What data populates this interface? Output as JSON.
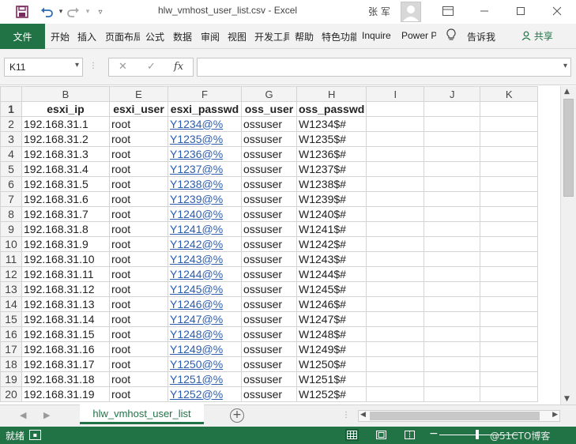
{
  "titlebar": {
    "title": "hlw_vmhost_user_list.csv  -  Excel",
    "user": "张 军",
    "icons": [
      "save-icon",
      "undo-icon",
      "redo-icon",
      "customize-qat-icon",
      "avatar",
      "ribbon-display-icon",
      "minimize-icon",
      "maximize-icon",
      "close-icon"
    ]
  },
  "ribbon": {
    "file_tab": "文件",
    "tabs": [
      "开始",
      "插入",
      "页面布局",
      "公式",
      "数据",
      "审阅",
      "视图",
      "开发工具",
      "帮助",
      "特色功能",
      "Inquire",
      "Power Pivot"
    ],
    "tell_me": "告诉我",
    "share": "共享"
  },
  "formula_bar": {
    "name_box": "K11",
    "cancel_glyph": "✕",
    "enter_glyph": "✓",
    "fx_label": "fx",
    "formula": ""
  },
  "sheet": {
    "column_headers": [
      "B",
      "E",
      "F",
      "G",
      "H",
      "I",
      "J",
      "K"
    ],
    "header_row": {
      "row": "1",
      "cells": [
        "esxi_ip",
        "esxi_user",
        "esxi_passwd",
        "oss_user",
        "oss_passwd",
        "",
        "",
        ""
      ]
    },
    "rows": [
      {
        "row": "2",
        "cells": [
          "192.168.31.1",
          "root",
          "Y1234@%",
          "ossuser",
          "W1234$#",
          "",
          "",
          ""
        ]
      },
      {
        "row": "3",
        "cells": [
          "192.168.31.2",
          "root",
          "Y1235@%",
          "ossuser",
          "W1235$#",
          "",
          "",
          ""
        ]
      },
      {
        "row": "4",
        "cells": [
          "192.168.31.3",
          "root",
          "Y1236@%",
          "ossuser",
          "W1236$#",
          "",
          "",
          ""
        ]
      },
      {
        "row": "5",
        "cells": [
          "192.168.31.4",
          "root",
          "Y1237@%",
          "ossuser",
          "W1237$#",
          "",
          "",
          ""
        ]
      },
      {
        "row": "6",
        "cells": [
          "192.168.31.5",
          "root",
          "Y1238@%",
          "ossuser",
          "W1238$#",
          "",
          "",
          ""
        ]
      },
      {
        "row": "7",
        "cells": [
          "192.168.31.6",
          "root",
          "Y1239@%",
          "ossuser",
          "W1239$#",
          "",
          "",
          ""
        ]
      },
      {
        "row": "8",
        "cells": [
          "192.168.31.7",
          "root",
          "Y1240@%",
          "ossuser",
          "W1240$#",
          "",
          "",
          ""
        ]
      },
      {
        "row": "9",
        "cells": [
          "192.168.31.8",
          "root",
          "Y1241@%",
          "ossuser",
          "W1241$#",
          "",
          "",
          ""
        ]
      },
      {
        "row": "10",
        "cells": [
          "192.168.31.9",
          "root",
          "Y1242@%",
          "ossuser",
          "W1242$#",
          "",
          "",
          ""
        ]
      },
      {
        "row": "11",
        "cells": [
          "192.168.31.10",
          "root",
          "Y1243@%",
          "ossuser",
          "W1243$#",
          "",
          "",
          ""
        ]
      },
      {
        "row": "12",
        "cells": [
          "192.168.31.11",
          "root",
          "Y1244@%",
          "ossuser",
          "W1244$#",
          "",
          "",
          ""
        ]
      },
      {
        "row": "13",
        "cells": [
          "192.168.31.12",
          "root",
          "Y1245@%",
          "ossuser",
          "W1245$#",
          "",
          "",
          ""
        ]
      },
      {
        "row": "14",
        "cells": [
          "192.168.31.13",
          "root",
          "Y1246@%",
          "ossuser",
          "W1246$#",
          "",
          "",
          ""
        ]
      },
      {
        "row": "15",
        "cells": [
          "192.168.31.14",
          "root",
          "Y1247@%",
          "ossuser",
          "W1247$#",
          "",
          "",
          ""
        ]
      },
      {
        "row": "16",
        "cells": [
          "192.168.31.15",
          "root",
          "Y1248@%",
          "ossuser",
          "W1248$#",
          "",
          "",
          ""
        ]
      },
      {
        "row": "17",
        "cells": [
          "192.168.31.16",
          "root",
          "Y1249@%",
          "ossuser",
          "W1249$#",
          "",
          "",
          ""
        ]
      },
      {
        "row": "18",
        "cells": [
          "192.168.31.17",
          "root",
          "Y1250@%",
          "ossuser",
          "W1250$#",
          "",
          "",
          ""
        ]
      },
      {
        "row": "19",
        "cells": [
          "192.168.31.18",
          "root",
          "Y1251@%",
          "ossuser",
          "W1251$#",
          "",
          "",
          ""
        ]
      },
      {
        "row": "20",
        "cells": [
          "192.168.31.19",
          "root",
          "Y1252@%",
          "ossuser",
          "W1252$#",
          "",
          "",
          ""
        ]
      }
    ]
  },
  "sheet_tabs": {
    "active": "hlw_vmhost_user_list"
  },
  "statusbar": {
    "status": "就绪",
    "watermark": "@51CTO博客"
  },
  "colors": {
    "excel_green": "#217346",
    "link_blue": "#2a5db0"
  }
}
